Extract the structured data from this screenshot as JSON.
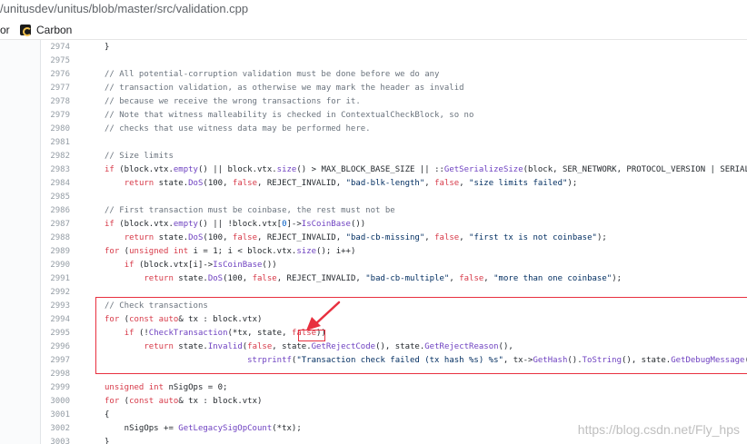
{
  "browser": {
    "url": "/unitusdev/unitus/blob/master/src/validation.cpp",
    "bookmarks": [
      {
        "label": "or"
      },
      {
        "label": "Carbon",
        "icon": "carbon-icon"
      }
    ]
  },
  "colors": {
    "keyword": "#d73a49",
    "function": "#6f42c1",
    "string": "#032f62",
    "comment": "#6a737d",
    "highlight": "#e8303f"
  },
  "code": {
    "lines": [
      {
        "n": "2974",
        "tokens": [
          {
            "t": "}"
          }
        ]
      },
      {
        "n": "2975",
        "tokens": []
      },
      {
        "n": "2976",
        "tokens": [
          {
            "t": "// All potential-corruption validation must be done before we do any",
            "c": "c"
          }
        ]
      },
      {
        "n": "2977",
        "tokens": [
          {
            "t": "// transaction validation, as otherwise we may mark the header as invalid",
            "c": "c"
          }
        ]
      },
      {
        "n": "2978",
        "tokens": [
          {
            "t": "// because we receive the wrong transactions for it.",
            "c": "c"
          }
        ]
      },
      {
        "n": "2979",
        "tokens": [
          {
            "t": "// Note that witness malleability is checked in ContextualCheckBlock, so no",
            "c": "c"
          }
        ]
      },
      {
        "n": "2980",
        "tokens": [
          {
            "t": "// checks that use witness data may be performed here.",
            "c": "c"
          }
        ]
      },
      {
        "n": "2981",
        "tokens": []
      },
      {
        "n": "2982",
        "tokens": [
          {
            "t": "// Size limits",
            "c": "c"
          }
        ]
      },
      {
        "n": "2983",
        "tokens": [
          {
            "t": "if",
            "c": "k"
          },
          {
            "t": " (block.vtx."
          },
          {
            "t": "empty",
            "c": "f"
          },
          {
            "t": "() || block.vtx."
          },
          {
            "t": "size",
            "c": "f"
          },
          {
            "t": "() > MAX_BLOCK_BASE_SIZE || ::"
          },
          {
            "t": "GetSerializeSize",
            "c": "f"
          },
          {
            "t": "(block, SER_NETWORK, PROTOCOL_VERSION | SERIALIZE_"
          }
        ]
      },
      {
        "n": "2984",
        "tokens": [
          {
            "t": "    "
          },
          {
            "t": "return",
            "c": "k"
          },
          {
            "t": " state."
          },
          {
            "t": "DoS",
            "c": "f"
          },
          {
            "t": "(100, "
          },
          {
            "t": "false",
            "c": "k"
          },
          {
            "t": ", REJECT_INVALID, "
          },
          {
            "t": "\"bad-blk-length\"",
            "c": "s"
          },
          {
            "t": ", "
          },
          {
            "t": "false",
            "c": "k"
          },
          {
            "t": ", "
          },
          {
            "t": "\"size limits failed\"",
            "c": "s"
          },
          {
            "t": ");"
          }
        ]
      },
      {
        "n": "2985",
        "tokens": []
      },
      {
        "n": "2986",
        "tokens": [
          {
            "t": "// First transaction must be coinbase, the rest must not be",
            "c": "c"
          }
        ]
      },
      {
        "n": "2987",
        "tokens": [
          {
            "t": "if",
            "c": "k"
          },
          {
            "t": " (block.vtx."
          },
          {
            "t": "empty",
            "c": "f"
          },
          {
            "t": "() || !block.vtx["
          },
          {
            "t": "0",
            "c": "n"
          },
          {
            "t": "]->"
          },
          {
            "t": "IsCoinBase",
            "c": "f"
          },
          {
            "t": "())"
          }
        ]
      },
      {
        "n": "2988",
        "tokens": [
          {
            "t": "    "
          },
          {
            "t": "return",
            "c": "k"
          },
          {
            "t": " state."
          },
          {
            "t": "DoS",
            "c": "f"
          },
          {
            "t": "(100, "
          },
          {
            "t": "false",
            "c": "k"
          },
          {
            "t": ", REJECT_INVALID, "
          },
          {
            "t": "\"bad-cb-missing\"",
            "c": "s"
          },
          {
            "t": ", "
          },
          {
            "t": "false",
            "c": "k"
          },
          {
            "t": ", "
          },
          {
            "t": "\"first tx is not coinbase\"",
            "c": "s"
          },
          {
            "t": ");"
          }
        ]
      },
      {
        "n": "2989",
        "tokens": [
          {
            "t": "for",
            "c": "k"
          },
          {
            "t": " ("
          },
          {
            "t": "unsigned int",
            "c": "k"
          },
          {
            "t": " i = 1; i < block.vtx."
          },
          {
            "t": "size",
            "c": "f"
          },
          {
            "t": "(); i++)"
          }
        ]
      },
      {
        "n": "2990",
        "tokens": [
          {
            "t": "    "
          },
          {
            "t": "if",
            "c": "k"
          },
          {
            "t": " (block.vtx[i]->"
          },
          {
            "t": "IsCoinBase",
            "c": "f"
          },
          {
            "t": "())"
          }
        ]
      },
      {
        "n": "2991",
        "tokens": [
          {
            "t": "        "
          },
          {
            "t": "return",
            "c": "k"
          },
          {
            "t": " state."
          },
          {
            "t": "DoS",
            "c": "f"
          },
          {
            "t": "(100, "
          },
          {
            "t": "false",
            "c": "k"
          },
          {
            "t": ", REJECT_INVALID, "
          },
          {
            "t": "\"bad-cb-multiple\"",
            "c": "s"
          },
          {
            "t": ", "
          },
          {
            "t": "false",
            "c": "k"
          },
          {
            "t": ", "
          },
          {
            "t": "\"more than one coinbase\"",
            "c": "s"
          },
          {
            "t": ");"
          }
        ]
      },
      {
        "n": "2992",
        "tokens": []
      },
      {
        "n": "2993",
        "tokens": [
          {
            "t": "// Check transactions",
            "c": "c"
          }
        ]
      },
      {
        "n": "2994",
        "tokens": [
          {
            "t": "for",
            "c": "k"
          },
          {
            "t": " ("
          },
          {
            "t": "const",
            "c": "k"
          },
          {
            "t": " "
          },
          {
            "t": "auto",
            "c": "k"
          },
          {
            "t": "& tx : block.vtx)"
          }
        ]
      },
      {
        "n": "2995",
        "tokens": [
          {
            "t": "    "
          },
          {
            "t": "if",
            "c": "k"
          },
          {
            "t": " (!"
          },
          {
            "t": "CheckTransaction",
            "c": "f"
          },
          {
            "t": "(*tx, state, "
          },
          {
            "t": "false",
            "c": "k"
          },
          {
            "t": "))"
          }
        ]
      },
      {
        "n": "2996",
        "tokens": [
          {
            "t": "        "
          },
          {
            "t": "return",
            "c": "k"
          },
          {
            "t": " state."
          },
          {
            "t": "Invalid",
            "c": "f"
          },
          {
            "t": "("
          },
          {
            "t": "false",
            "c": "k"
          },
          {
            "t": ", state."
          },
          {
            "t": "GetRejectCode",
            "c": "f"
          },
          {
            "t": "(), state."
          },
          {
            "t": "GetRejectReason",
            "c": "f"
          },
          {
            "t": "(),"
          }
        ]
      },
      {
        "n": "2997",
        "tokens": [
          {
            "t": "                             "
          },
          {
            "t": "strprintf",
            "c": "f"
          },
          {
            "t": "("
          },
          {
            "t": "\"Transaction check failed (tx hash %s) %s\"",
            "c": "s"
          },
          {
            "t": ", tx->"
          },
          {
            "t": "GetHash",
            "c": "f"
          },
          {
            "t": "()."
          },
          {
            "t": "ToString",
            "c": "f"
          },
          {
            "t": "(), state."
          },
          {
            "t": "GetDebugMessage",
            "c": "f"
          },
          {
            "t": "()))"
          }
        ]
      },
      {
        "n": "2998",
        "tokens": []
      },
      {
        "n": "2999",
        "tokens": [
          {
            "t": "unsigned int",
            "c": "k"
          },
          {
            "t": " nSigOps = 0;"
          }
        ]
      },
      {
        "n": "3000",
        "tokens": [
          {
            "t": "for",
            "c": "k"
          },
          {
            "t": " ("
          },
          {
            "t": "const",
            "c": "k"
          },
          {
            "t": " "
          },
          {
            "t": "auto",
            "c": "k"
          },
          {
            "t": "& tx : block.vtx)"
          }
        ]
      },
      {
        "n": "3001",
        "tokens": [
          {
            "t": "{"
          }
        ]
      },
      {
        "n": "3002",
        "tokens": [
          {
            "t": "    nSigOps += "
          },
          {
            "t": "GetLegacySigOpCount",
            "c": "f"
          },
          {
            "t": "(*tx);"
          }
        ]
      },
      {
        "n": "3003",
        "tokens": [
          {
            "t": "}"
          }
        ]
      }
    ]
  },
  "watermark": "https://blog.csdn.net/Fly_hps"
}
